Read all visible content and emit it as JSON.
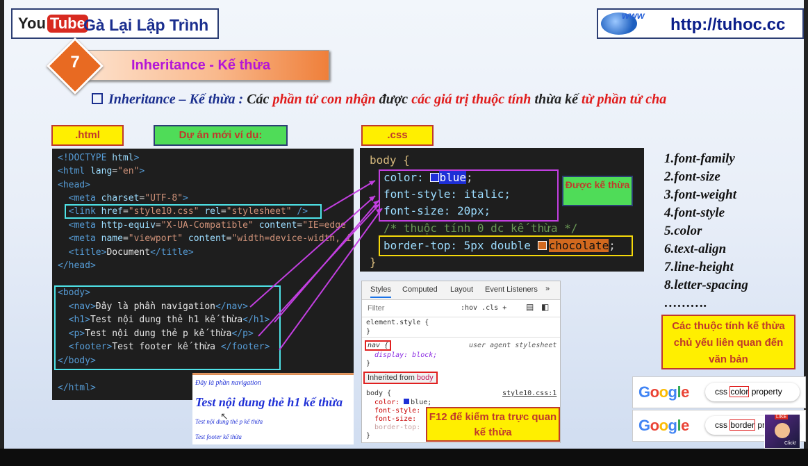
{
  "header": {
    "youtube_logo_left": "You",
    "youtube_logo_right": "Tube",
    "channel_title": "Gà Lại Lập Trình",
    "www_label": "www",
    "site_url": "http://tuhoc.cc"
  },
  "section": {
    "number": "7",
    "title": "Inheritance - Kế thừa"
  },
  "definition": {
    "part1": "Inheritance – Kế thừa : ",
    "part2": "Các ",
    "part3": "phần tử con nhận",
    "part4": " được ",
    "part5": "các giá trị thuộc tính",
    "part6": " thừa kế ",
    "part7": "từ phần tử cha"
  },
  "labels": {
    "html": ".html",
    "project": "Dự án mới ví dụ:",
    "css": ".css",
    "inherited_note": "Được kế thừa",
    "text_props_note": "Các thuộc tính kế thừa chủ yếu liên quan đến văn bản",
    "f12_note": "F12 để kiểm tra trực quan kế thừa"
  },
  "html_code": [
    "<!DOCTYPE html>",
    "<html lang=\"en\">",
    "<head>",
    "  <meta charset=\"UTF-8\">",
    "  <link href=\"style10.css\" rel=\"stylesheet\" />",
    "  <meta http-equiv=\"X-UA-Compatible\" content=\"IE=edge",
    "  <meta name=\"viewport\" content=\"width=device-width, i",
    "  <title>Document</title>",
    "</head>",
    "",
    "<body>",
    "  <nav>Đây là phần navigation</nav>",
    "  <h1>Test nội dung thẻ h1 kế thừa</h1>",
    "  <p>Test nội dung thẻ p kế thừa</p>",
    "  <footer>Test footer kế thừa </footer>",
    "</body>",
    "",
    "</html>"
  ],
  "css_code": {
    "selector": "body {",
    "line1_prop": "color:",
    "line1_val": "blue",
    "line2": "font-style: italic;",
    "line3": "font-size: 20px;",
    "comment": "/* thuộc tính 0 dc kế thừa */",
    "line4_prop": "border-top: 5px double ",
    "line4_val": "chocolate",
    "close": "}",
    "color_blue": "#1e2fd6",
    "color_chocolate": "#d2691e"
  },
  "browser_preview": {
    "nav": "Đây là phần navigation",
    "h1": "Test nội dung thẻ h1 kế thừa",
    "p": "Test nội dung thẻ p kế thừa",
    "footer": "Test footer kế thừa"
  },
  "devtools": {
    "tabs": [
      "Styles",
      "Computed",
      "Layout",
      "Event Listeners",
      "»"
    ],
    "filter_placeholder": "Filter",
    "filter_tools": ":hov .cls +",
    "element_style": "element.style {",
    "close_brace": "}",
    "nav_selector": "nav {",
    "nav_source": "user agent stylesheet",
    "nav_rule": "display: block;",
    "inherited_from_label": "Inherited from ",
    "inherited_from_tag": "body",
    "body_selector": "body {",
    "body_source": "style10.css:1",
    "body_rules": [
      "color: ",
      "font-style:",
      "font-size:",
      "border-top:"
    ],
    "body_color_value": "blue;"
  },
  "property_list": [
    "1.font-family",
    "2.font-size",
    "3.font-weight",
    "4.font-style",
    "5.color",
    "6.text-align",
    "7.line-height",
    "8.letter-spacing",
    "………."
  ],
  "google_searches": [
    {
      "logo": "Google",
      "pre": "css ",
      "term": "color",
      "post": " property"
    },
    {
      "logo": "Google",
      "pre": "css ",
      "term": "border",
      "post": " prop"
    }
  ],
  "avatar": {
    "badge": "LIKE",
    "caption": "Click!"
  }
}
